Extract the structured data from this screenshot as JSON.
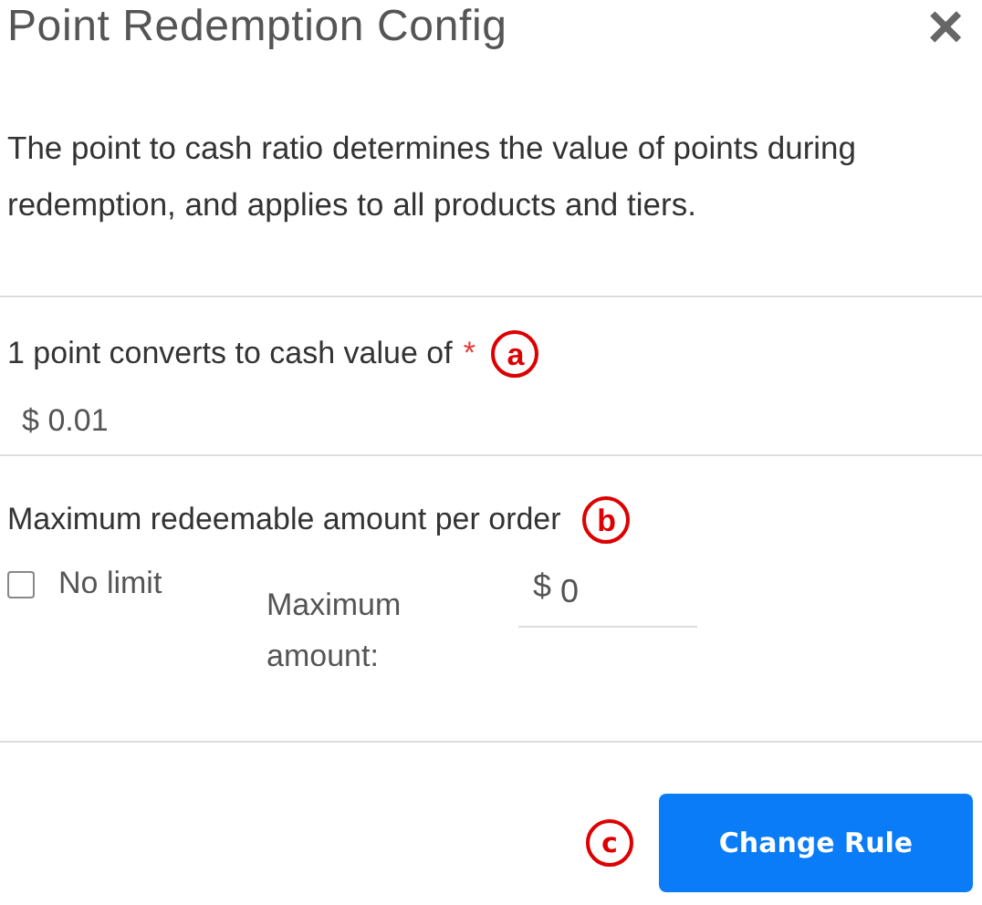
{
  "dialog": {
    "title": "Point Redemption Config",
    "close": "×",
    "description": "The point to cash ratio determines the value of points during redemption, and applies to all products and tiers."
  },
  "ratio": {
    "label": "1 point converts to cash value of",
    "required_mark": "*",
    "marker": "a",
    "currency": "$",
    "value": "0.01"
  },
  "max_amount": {
    "label": "Maximum redeemable amount per order",
    "marker": "b",
    "no_limit": {
      "label": "No limit",
      "checked": false
    },
    "field_label": "Maximum amount:",
    "currency": "$",
    "value": "0"
  },
  "footer": {
    "marker": "c",
    "button": "Change Rule"
  }
}
